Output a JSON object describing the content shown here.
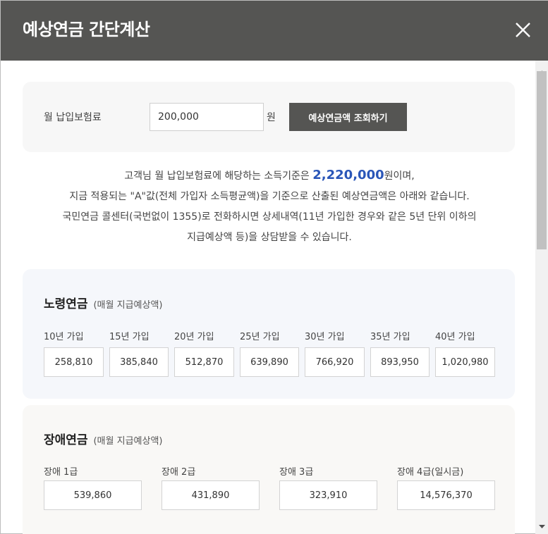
{
  "header": {
    "title": "예상연금 간단계산"
  },
  "input": {
    "label": "월 납입보험료",
    "value": "200,000",
    "unit": "원",
    "button_label": "예상연금액 조회하기"
  },
  "info": {
    "line1_pre": "고객님 월 납입보험료에 해당하는 소득기준은 ",
    "line1_amount": "2,220,000",
    "line1_post": "원이며,",
    "line2": "지금 적용되는 \"A\"값(전체 가입자 소득평균액)을 기준으로 산출된 예상연금액은 아래와 같습니다.",
    "line3": "국민연금 콜센터(국번없이 1355)로 전화하시면 상세내역(11년 가입한 경우와 같은 5년 단위 이하의",
    "line4": "지급예상액 등)을 상담받을 수 있습니다."
  },
  "old_age": {
    "title": "노령연금",
    "subtitle": "(매월 지급예상액)",
    "items": [
      {
        "label": "10년 가입",
        "value": "258,810"
      },
      {
        "label": "15년 가입",
        "value": "385,840"
      },
      {
        "label": "20년 가입",
        "value": "512,870"
      },
      {
        "label": "25년 가입",
        "value": "639,890"
      },
      {
        "label": "30년 가입",
        "value": "766,920"
      },
      {
        "label": "35년 가입",
        "value": "893,950"
      },
      {
        "label": "40년 가입",
        "value": "1,020,980"
      }
    ]
  },
  "disability": {
    "title": "장애연금",
    "subtitle": "(매월 지급예상액)",
    "items": [
      {
        "label": "장애 1급",
        "value": "539,860"
      },
      {
        "label": "장애 2급",
        "value": "431,890"
      },
      {
        "label": "장애 3급",
        "value": "323,910"
      },
      {
        "label": "장애 4급(일시금)",
        "value": "14,576,370"
      }
    ]
  },
  "icons": {
    "close": "close-icon",
    "scroll_up": "arrow-up-icon",
    "scroll_down": "arrow-down-icon"
  },
  "colors": {
    "header_bg": "#555553",
    "highlight": "#2a56b8",
    "button_bg": "#555553"
  }
}
